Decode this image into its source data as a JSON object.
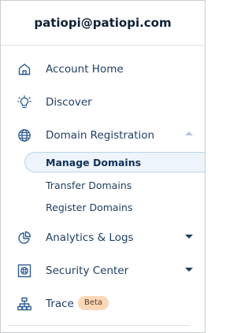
{
  "account": {
    "name": "patiopi@patiopi.com"
  },
  "nav": {
    "account_home": {
      "label": "Account Home",
      "icon": "home-icon"
    },
    "discover": {
      "label": "Discover",
      "icon": "lightbulb-icon"
    },
    "domain_registration": {
      "label": "Domain Registration",
      "icon": "globe-icon",
      "expanded": true
    },
    "domain_sub": {
      "manage": {
        "label": "Manage Domains",
        "selected": true
      },
      "transfer": {
        "label": "Transfer Domains"
      },
      "register": {
        "label": "Register Domains"
      }
    },
    "analytics": {
      "label": "Analytics & Logs",
      "icon": "pie-chart-icon",
      "expanded": false
    },
    "security": {
      "label": "Security Center",
      "icon": "shield-grid-icon",
      "expanded": false
    },
    "trace": {
      "label": "Trace",
      "icon": "network-tree-icon",
      "badge": "Beta"
    }
  },
  "colors": {
    "text": "#213f66",
    "active_bg": "#eef4fb",
    "active_border": "#b8d3ee",
    "badge_bg": "#fbd7b5"
  }
}
